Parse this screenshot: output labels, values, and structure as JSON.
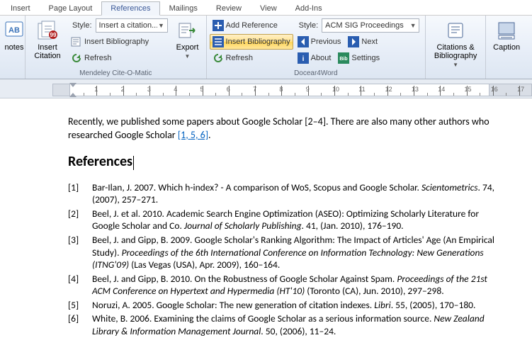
{
  "tabs": {
    "insert": "Insert",
    "pagelayout": "Page Layout",
    "references": "References",
    "mailings": "Mailings",
    "review": "Review",
    "view": "View",
    "addins": "Add-Ins"
  },
  "mendeley": {
    "group": "Mendeley Cite-O-Matic",
    "stylelabel": "Style:",
    "stylecombo": "Insert a citation...",
    "insertbib": "Insert Bibliography",
    "refresh": "Refresh",
    "insertcitation": "Insert Citation",
    "export": "Export"
  },
  "docear": {
    "group": "Docear4Word",
    "addref": "Add Reference",
    "insertbib": "Insert Bibliography",
    "refresh": "Refresh",
    "stylelabel": "Style:",
    "stylecombo": "ACM SIG Proceedings",
    "previous": "Previous",
    "next": "Next",
    "about": "About",
    "settings": "Settings"
  },
  "right": {
    "citations": "Citations & Bibliography",
    "caption": "Caption"
  },
  "doc": {
    "para1a": "Recently, we published some papers about Google Scholar [2–4]. There are also many other authors who researched Google Scholar ",
    "para1link": "[1, 5, 6]",
    "para1b": ".",
    "heading": "References",
    "refs": [
      {
        "n": "[1]",
        "text": "Bar-Ilan, J. 2007.  Which h-index? - A comparison of WoS, Scopus and Google Scholar. ",
        "ital": "Scientometrics",
        "rest": ". 74, (2007), 257–271."
      },
      {
        "n": "[2]",
        "text": "Beel, J. et al. 2010.  Academic Search Engine Optimization (ASEO): Optimizing Scholarly Literature for Google Scholar and Co. ",
        "ital": "Journal of Scholarly Publishing",
        "rest": ". 41, (Jan. 2010), 176–190."
      },
      {
        "n": "[3]",
        "text": "Beel, J. and Gipp, B. 2009.  Google Scholar's Ranking Algorithm: The Impact of Articles' Age (An Empirical Study). ",
        "ital": "Proceedings of the 6th International Conference on Information Technology: New Generations (ITNG'09)",
        "rest": " (Las Vegas (USA), Apr. 2009), 160–164."
      },
      {
        "n": "[4]",
        "text": "Beel, J. and Gipp, B. 2010.  On the Robustness of Google Scholar Against Spam. ",
        "ital": "Proceedings of the 21st ACM Conference on Hypertext and Hypermedia (HT'10)",
        "rest": " (Toronto (CA), Jun. 2010), 297–298."
      },
      {
        "n": "[5]",
        "text": "Noruzi, A. 2005.  Google Scholar: The new generation of citation indexes. ",
        "ital": "Libri",
        "rest": ". 55, (2005), 170–180."
      },
      {
        "n": "[6]",
        "text": "White, B. 2006.  Examining the claims of Google Scholar as a serious information source. ",
        "ital": "New Zealand Library & Information Management Journal",
        "rest": ". 50, (2006), 11–24."
      }
    ]
  }
}
